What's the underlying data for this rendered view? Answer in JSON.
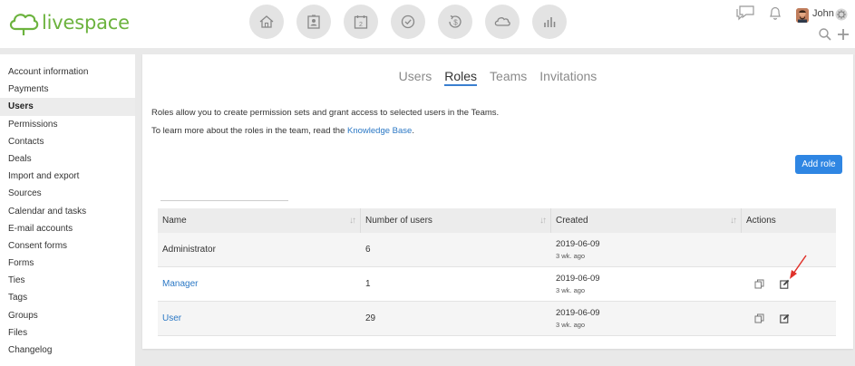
{
  "app": {
    "logo_text": "livespace"
  },
  "top_nav": {
    "icons": [
      "home-icon",
      "contacts-card-icon",
      "calendar-icon",
      "tasks-check-icon",
      "money-icon",
      "cloud-icon",
      "reports-chart-icon"
    ],
    "calendar_day": "2"
  },
  "user": {
    "name": "John"
  },
  "sidebar": {
    "items": [
      {
        "label": "Account information",
        "active": false
      },
      {
        "label": "Payments",
        "active": false
      },
      {
        "label": "Users",
        "active": true
      },
      {
        "label": "Permissions",
        "active": false
      },
      {
        "label": "Contacts",
        "active": false
      },
      {
        "label": "Deals",
        "active": false
      },
      {
        "label": "Import and export",
        "active": false
      },
      {
        "label": "Sources",
        "active": false
      },
      {
        "label": "Calendar and tasks",
        "active": false
      },
      {
        "label": "E-mail accounts",
        "active": false
      },
      {
        "label": "Consent forms",
        "active": false
      },
      {
        "label": "Forms",
        "active": false
      },
      {
        "label": "Ties",
        "active": false
      },
      {
        "label": "Tags",
        "active": false
      },
      {
        "label": "Groups",
        "active": false
      },
      {
        "label": "Files",
        "active": false
      },
      {
        "label": "Changelog",
        "active": false
      }
    ]
  },
  "tabs": [
    {
      "label": "Users",
      "active": false
    },
    {
      "label": "Roles",
      "active": true
    },
    {
      "label": "Teams",
      "active": false
    },
    {
      "label": "Invitations",
      "active": false
    }
  ],
  "description": {
    "line1": "Roles allow you to create permission sets and grant access to selected users in the Teams.",
    "line2_prefix": "To learn more about the roles in the team, read the ",
    "line2_link": "Knowledge Base",
    "line2_suffix": "."
  },
  "add_role_label": "Add role",
  "table": {
    "headers": {
      "name": "Name",
      "users": "Number of users",
      "created": "Created",
      "actions": "Actions"
    },
    "sort_glyph": "↓↑",
    "rows": [
      {
        "name": "Administrator",
        "users": "6",
        "date": "2019-06-09",
        "ago": "3 wk. ago"
      },
      {
        "name": "Manager",
        "users": "1",
        "date": "2019-06-09",
        "ago": "3 wk. ago"
      },
      {
        "name": "User",
        "users": "29",
        "date": "2019-06-09",
        "ago": "3 wk. ago"
      }
    ]
  },
  "colors": {
    "brand_green": "#6cb33e",
    "primary_blue": "#2f86e3",
    "link_blue": "#2b78c5",
    "annotation_red": "#e0312a"
  }
}
